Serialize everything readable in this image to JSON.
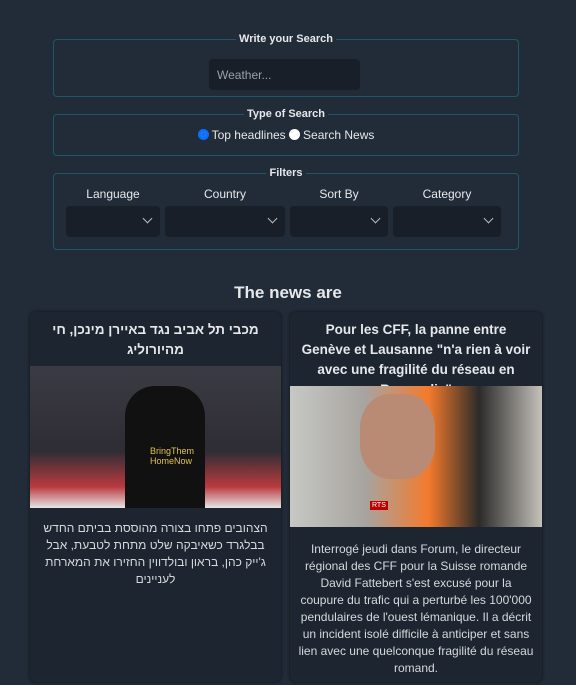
{
  "search": {
    "legend": "Write your Search",
    "placeholder": "Weather..."
  },
  "type": {
    "legend": "Type of Search",
    "options": [
      "Top headlines",
      "Search News"
    ],
    "selected": "Top headlines"
  },
  "filters": {
    "legend": "Filters",
    "labels": [
      "Language",
      "Country",
      "Sort By",
      "Category"
    ]
  },
  "heading": "The news are",
  "articles": [
    {
      "title": "מכבי תל אביב נגד באיירן מינכן, חי מהיורוליג",
      "image_text": "BringThem HomeNow",
      "description": "הצהובים פתחו בצורה מהוססת בביתם החדש בבלגרד כשאיבקה שלט מתחת לטבעת, אבל ג'ייק כהן, בראון ובולדווין החזירו את המארחת לעניינים"
    },
    {
      "title": "Pour les CFF, la panne entre Genève et Lausanne \"n'a rien à voir avec une fragilité du réseau en Romandie\"",
      "image_text": "RTS",
      "description": "Interrogé jeudi dans Forum, le directeur régional des CFF pour la Suisse romande David Fattebert s'est excusé pour la coupure du trafic qui a perturbé les 100'000 pendulaires de l'ouest lémanique. Il a décrit un incident isolé difficile à anticiper et sans lien avec une quelconque fragilité du réseau romand."
    }
  ]
}
